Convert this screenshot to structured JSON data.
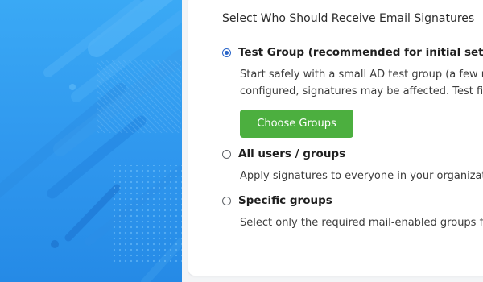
{
  "section": {
    "heading": "Select Who Should Receive Email Signatures"
  },
  "options": [
    {
      "label": "Test Group (recommended for initial setup)",
      "checked": true,
      "description_lines": [
        "Start safely with a small AD test group (a few mem",
        "configured, signatures may be affected. Test first,"
      ]
    },
    {
      "label": "All users / groups",
      "checked": false,
      "description_lines": [
        "Apply signatures to everyone in your organization"
      ]
    },
    {
      "label": "Specific groups",
      "checked": false,
      "description_lines": [
        "Select only the required mail-enabled groups for"
      ]
    }
  ],
  "choose_groups_button": "Choose Groups",
  "colors": {
    "hero_blue": "#2f97ee",
    "button_green": "#4caf3f",
    "radio_selected": "#2b66c9"
  }
}
